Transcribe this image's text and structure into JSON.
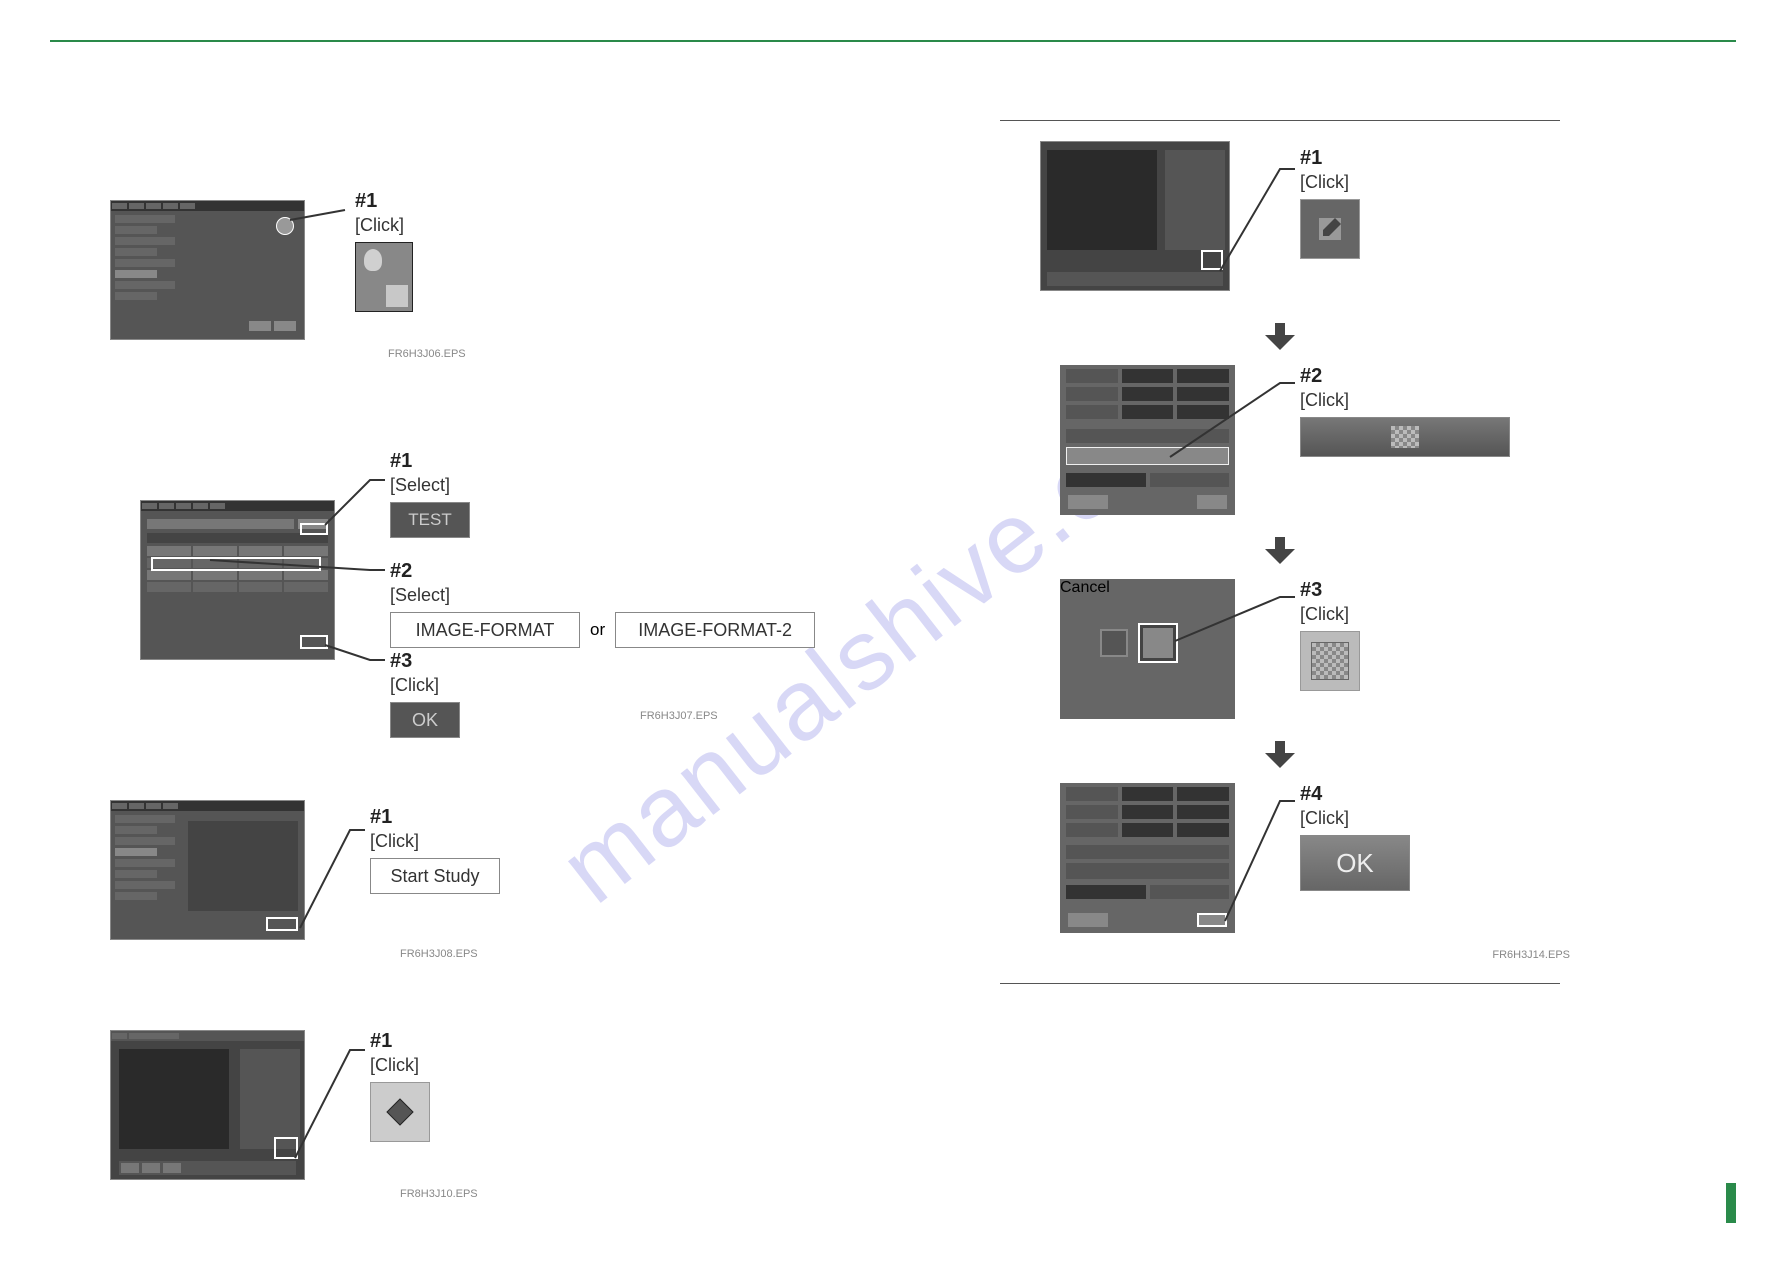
{
  "watermark": "manualshive.com",
  "left": {
    "step1": {
      "label": "#1",
      "action": "[Click]",
      "caption": "FR6H3J06.EPS"
    },
    "step2": {
      "c1_label": "#1",
      "c1_action": "[Select]",
      "c1_target": "TEST",
      "c2_label": "#2",
      "c2_action": "[Select]",
      "fmt1": "IMAGE-FORMAT",
      "or": "or",
      "fmt2": "IMAGE-FORMAT-2",
      "c3_label": "#3",
      "c3_action": "[Click]",
      "c3_target": "OK",
      "caption": "FR6H3J07.EPS"
    },
    "step3": {
      "label": "#1",
      "action": "[Click]",
      "target": "Start Study",
      "caption": "FR6H3J08.EPS"
    },
    "step4": {
      "label": "#1",
      "action": "[Click]",
      "caption": "FR8H3J10.EPS"
    }
  },
  "right": {
    "s1": {
      "label": "#1",
      "action": "[Click]"
    },
    "s2": {
      "label": "#2",
      "action": "[Click]"
    },
    "s3": {
      "label": "#3",
      "action": "[Click]",
      "cancel": "Cancel"
    },
    "s4": {
      "label": "#4",
      "action": "[Click]",
      "target": "OK"
    },
    "caption": "FR6H3J14.EPS"
  }
}
